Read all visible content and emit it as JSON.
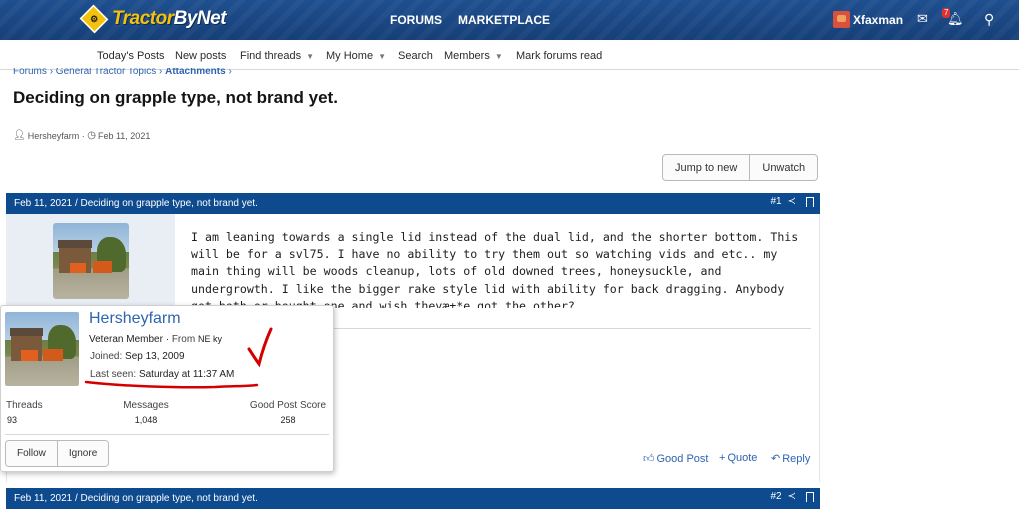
{
  "header": {
    "logo_prefix": "Tractor",
    "logo_suffix": "ByNet",
    "nav": [
      "FORUMS",
      "MARKETPLACE"
    ],
    "username": "Xfaxman",
    "alert_count": "7"
  },
  "subnav": {
    "items": [
      "Today's Posts",
      "New posts",
      "Find threads",
      "My Home",
      "Search",
      "Members",
      "Mark forums read"
    ]
  },
  "breadcrumb": {
    "items": [
      "Forums",
      "General Tractor Topics",
      "Attachments"
    ]
  },
  "thread": {
    "title": "Deciding on grapple type, not brand yet.",
    "author": "Hersheyfarm",
    "date": "Feb 11, 2021",
    "jump_label": "Jump to new",
    "watch_label": "Unwatch"
  },
  "post1": {
    "header": "Feb 11, 2021 / Deciding on grapple type, not brand yet.",
    "number": "#1",
    "body": "I am leaning towards a single lid instead of the dual lid, and the shorter bottom. This will be for a svl75. I have no ability to try them out so watching vids and etc.. my main thing will be woods cleanup, lots of old downed trees, honeysuckle, and undergrowth. I like the bigger rake style lid with ability for back dragging. Anybody got both or bought one and wish theyæ±*e got the other?",
    "actions": {
      "good_post": "Good Post",
      "quote": "Quote",
      "reply": "Reply"
    }
  },
  "post2": {
    "header": "Feb 11, 2021 / Deciding on grapple type, not brand yet.",
    "number": "#2"
  },
  "member_card": {
    "name": "Hersheyfarm",
    "title": "Veteran Member",
    "from_label": "From",
    "from_value": "NE ky",
    "joined_label": "Joined:",
    "joined_value": "Sep 13, 2009",
    "last_seen_label": "Last seen:",
    "last_seen_value": "Saturday at 11:37 AM",
    "stats": [
      {
        "label": "Threads",
        "value": "93"
      },
      {
        "label": "Messages",
        "value": "1,048"
      },
      {
        "label": "Good Post Score",
        "value": "258"
      }
    ],
    "follow_label": "Follow",
    "ignore_label": "Ignore"
  },
  "colors": {
    "header_bg": "#163f78",
    "post_header_bg": "#0d4a8e",
    "link": "#2e64b0",
    "logo_yellow": "#f4c20d",
    "annotation_red": "#d40000"
  },
  "icons": [
    "tractor-logo-icon",
    "mail-icon",
    "bell-icon",
    "search-icon",
    "user-icon",
    "clock-icon",
    "share-icon",
    "bookmark-icon",
    "thumbs-up-icon",
    "plus-icon",
    "reply-icon"
  ]
}
